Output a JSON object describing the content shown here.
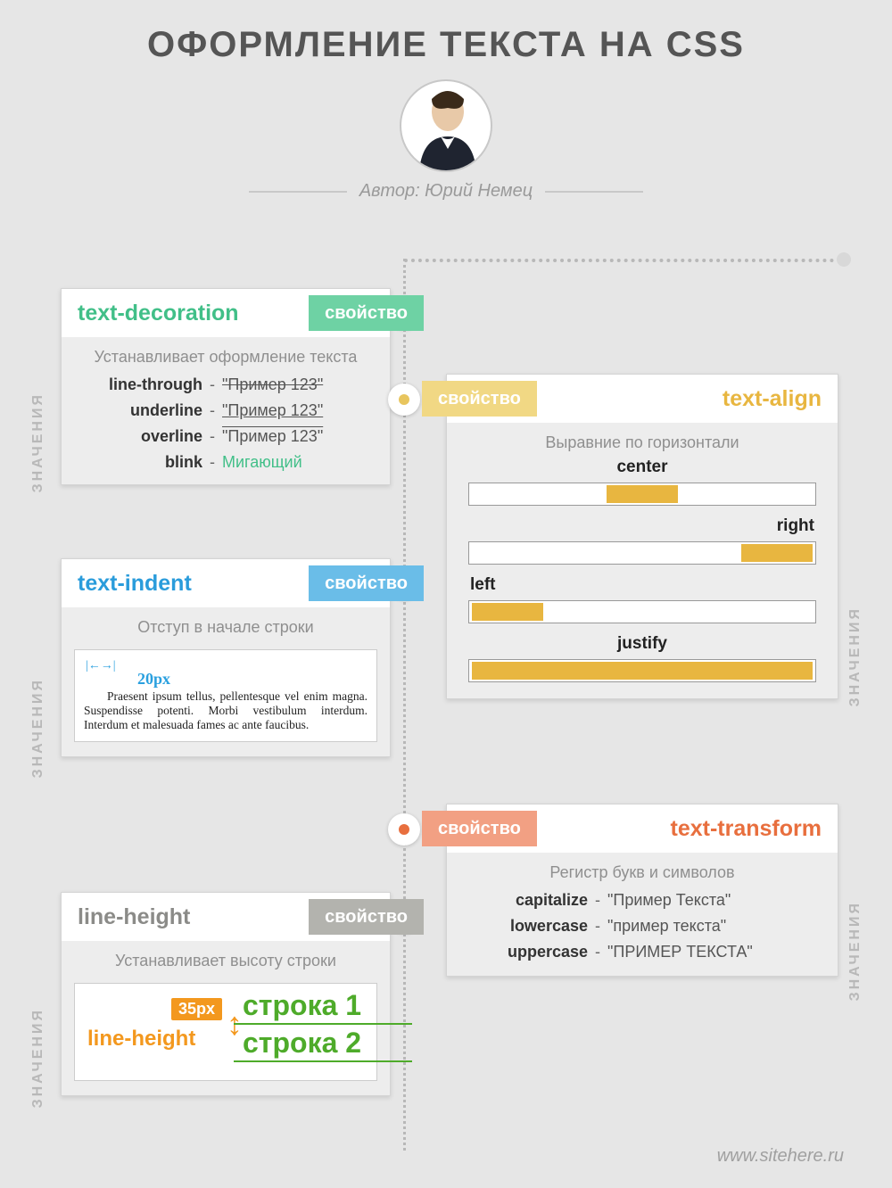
{
  "title": "ОФОРМЛЕНИЕ ТЕКСТА НА CSS",
  "author_line": "Автор: Юрий Немец",
  "badge_word": "свойство",
  "values_word": "ЗНАЧЕНИЯ",
  "footer": "www.sitehere.ru",
  "colors": {
    "green": "#41bf88",
    "blue": "#2a9cdb",
    "grey": "#8b8b88",
    "yellow": "#e8c55e",
    "orange": "#e86f3e"
  },
  "cards": {
    "decoration": {
      "name": "text-decoration",
      "sub": "Устанавливает оформление текста",
      "rows": [
        {
          "k": "line-through",
          "v": "\"Пример 123\"",
          "style": "strike"
        },
        {
          "k": "underline",
          "v": "\"Пример 123\"",
          "style": "under"
        },
        {
          "k": "overline",
          "v": "\"Пример 123\"",
          "style": "over"
        },
        {
          "k": "blink",
          "v": "Мигающий",
          "style": "blink"
        }
      ]
    },
    "align": {
      "name": "text-align",
      "sub": "Выравние по горизонтали",
      "items": [
        "center",
        "right",
        "left",
        "justify"
      ]
    },
    "indent": {
      "name": "text-indent",
      "sub": "Отступ в начале строки",
      "px": "20px",
      "sample": "Praesent ipsum tellus, pellentesque vel enim magna. Suspendisse potenti. Morbi vestibulum interdum. Interdum et malesuada fames ac ante faucibus."
    },
    "transform": {
      "name": "text-transform",
      "sub": "Регистр букв и символов",
      "rows": [
        {
          "k": "capitalize",
          "v": "\"Пример Текста\""
        },
        {
          "k": "lowercase",
          "v": "\"пример текста\""
        },
        {
          "k": "uppercase",
          "v": "\"ПРИМЕР ТЕКСТА\""
        }
      ]
    },
    "lineheight": {
      "name": "line-height",
      "sub": "Устанавливает высоту строки",
      "px": "35px",
      "lh_label": "line-height",
      "l1": "строка 1",
      "l2": "строка 2"
    }
  }
}
